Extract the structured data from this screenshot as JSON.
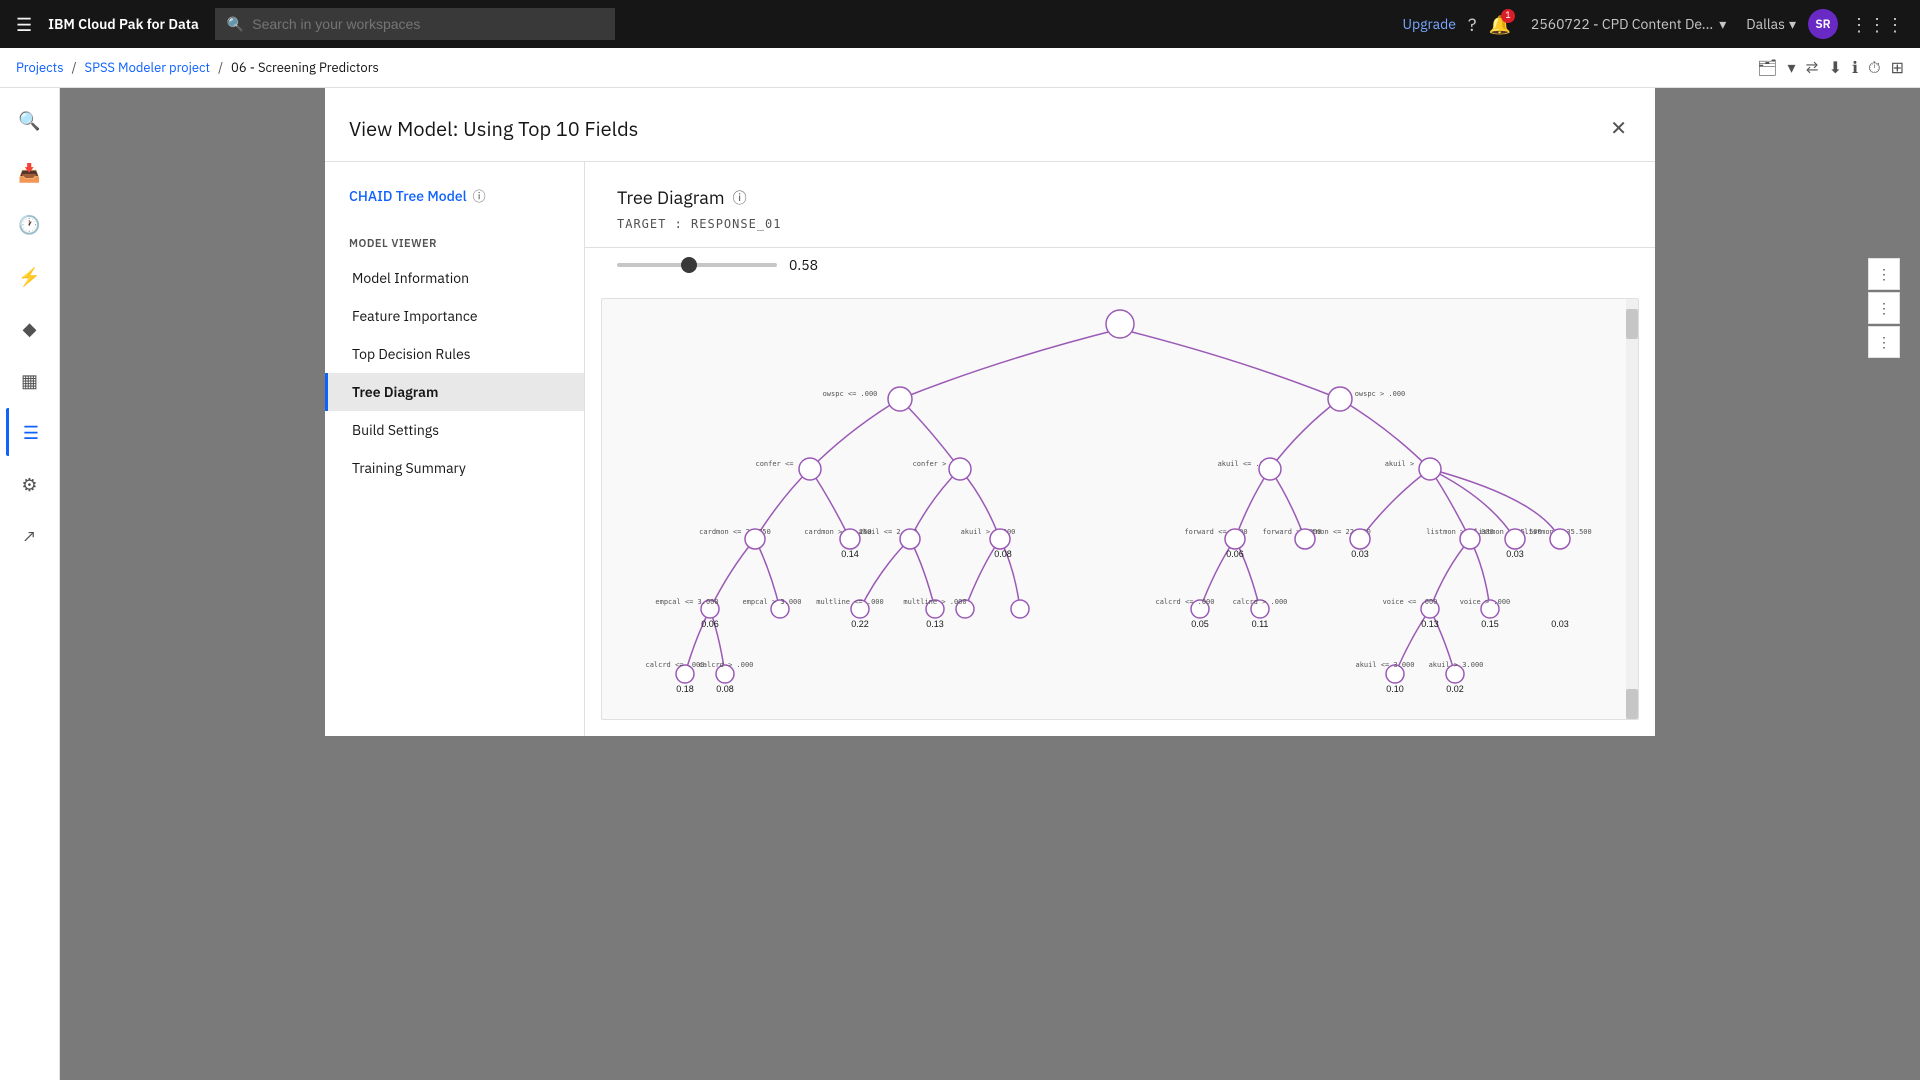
{
  "appName": "IBM Cloud Pak for Data",
  "topNav": {
    "searchPlaceholder": "Search in your workspaces",
    "upgradeLabel": "Upgrade",
    "notificationCount": "1",
    "accountLabel": "2560722 - CPD Content De...",
    "regionLabel": "Dallas",
    "userInitials": "SR"
  },
  "breadcrumb": {
    "projects": "Projects",
    "project": "SPSS Modeler project",
    "current": "06 - Screening Predictors"
  },
  "modal": {
    "title": "View Model: Using Top 10 Fields",
    "closeLabel": "✕",
    "sidebarTitle": "CHAID Tree Model",
    "sectionLabel": "MODEL VIEWER",
    "navItems": [
      {
        "id": "model-information",
        "label": "Model Information",
        "active": false
      },
      {
        "id": "feature-importance",
        "label": "Feature Importance",
        "active": false
      },
      {
        "id": "top-decision-rules",
        "label": "Top Decision Rules",
        "active": false
      },
      {
        "id": "tree-diagram",
        "label": "Tree Diagram",
        "active": true
      },
      {
        "id": "build-settings",
        "label": "Build Settings",
        "active": false
      },
      {
        "id": "training-summary",
        "label": "Training Summary",
        "active": false
      }
    ],
    "diagramTitle": "Tree Diagram",
    "targetLabel": "TARGET : RESPONSE_01",
    "sliderValue": "0.58"
  },
  "sidebar": {
    "icons": [
      {
        "id": "search",
        "symbol": "🔍"
      },
      {
        "id": "import",
        "symbol": "📥"
      },
      {
        "id": "recent",
        "symbol": "🕐"
      },
      {
        "id": "filter",
        "symbol": "⚡"
      },
      {
        "id": "diamond",
        "symbol": "◆"
      },
      {
        "id": "table",
        "symbol": "📊"
      },
      {
        "id": "overview",
        "symbol": "☰"
      },
      {
        "id": "tools",
        "symbol": "🛠"
      },
      {
        "id": "export",
        "symbol": "📤"
      }
    ]
  }
}
